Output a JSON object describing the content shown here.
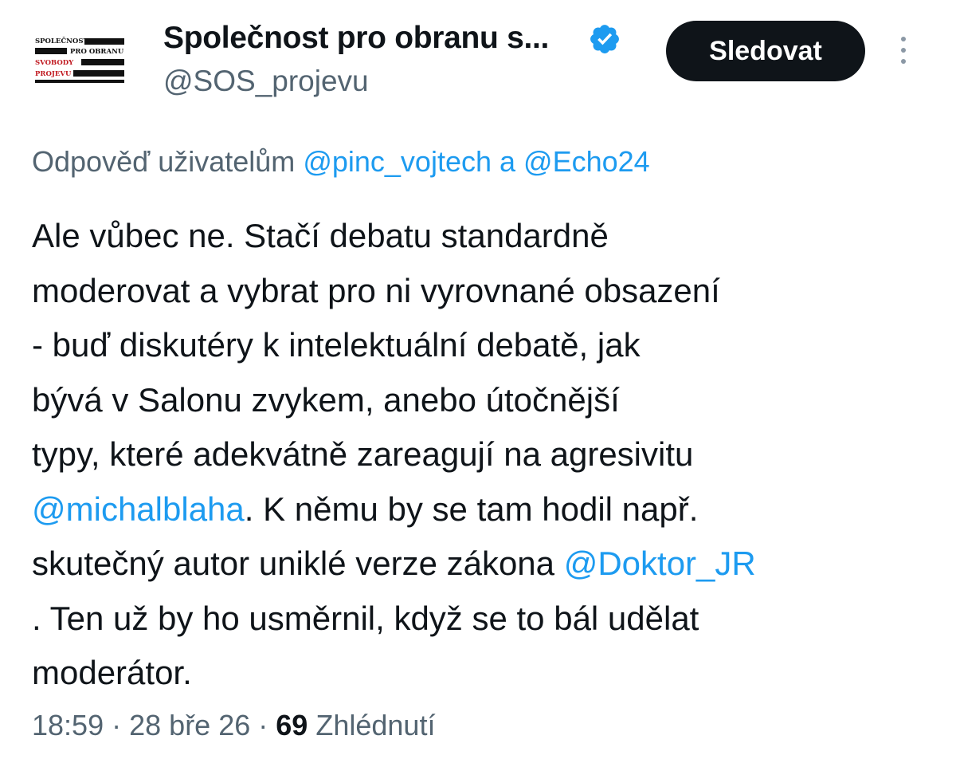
{
  "author": {
    "display_name": "Společnost pro obranu s...",
    "handle": "@SOS_projevu",
    "verified": true,
    "avatar_lines": [
      "SPOLEČNOST",
      "PRO OBRANU",
      "SVOBODY",
      "PROJEVU"
    ]
  },
  "follow_button": {
    "label": "Sledovat"
  },
  "reply_context": {
    "prefix": "Odpověď uživatelům",
    "mention1": "@pinc_vojtech",
    "joiner": "a",
    "mention2": "@Echo24"
  },
  "tweet": {
    "line1": "Ale vůbec ne. Stačí debatu standardně",
    "line2": "moderovat a vybrat pro ni vyrovnané obsazení",
    "line3": "- buď diskutéry k intelektuální debatě, jak",
    "line4": "bývá v Salonu zvykem, anebo útočnější",
    "line5": "typy, které adekvátně zareagují na agresivitu",
    "line6_mention": "@michalblaha",
    "line6_rest": ". K němu by se tam hodil např.",
    "line7_text": "skutečný autor uniklé verze zákona ",
    "line7_mention": "@Doktor_JR",
    "line8": ". Ten už by ho usměrnil, když se to bál udělat",
    "line9": "moderátor."
  },
  "meta": {
    "time": "18:59",
    "separator": "·",
    "date": "28 bře 26",
    "views_count": "69",
    "views_label": "Zhlédnutí"
  },
  "colors": {
    "text": "#0f1419",
    "secondary": "#536471",
    "link": "#1d9bf0",
    "verified_badge": "#1d9bf0",
    "button_bg": "#0f1419"
  },
  "icons": {
    "verified": "verified-badge-icon",
    "more": "more-vertical-icon"
  }
}
